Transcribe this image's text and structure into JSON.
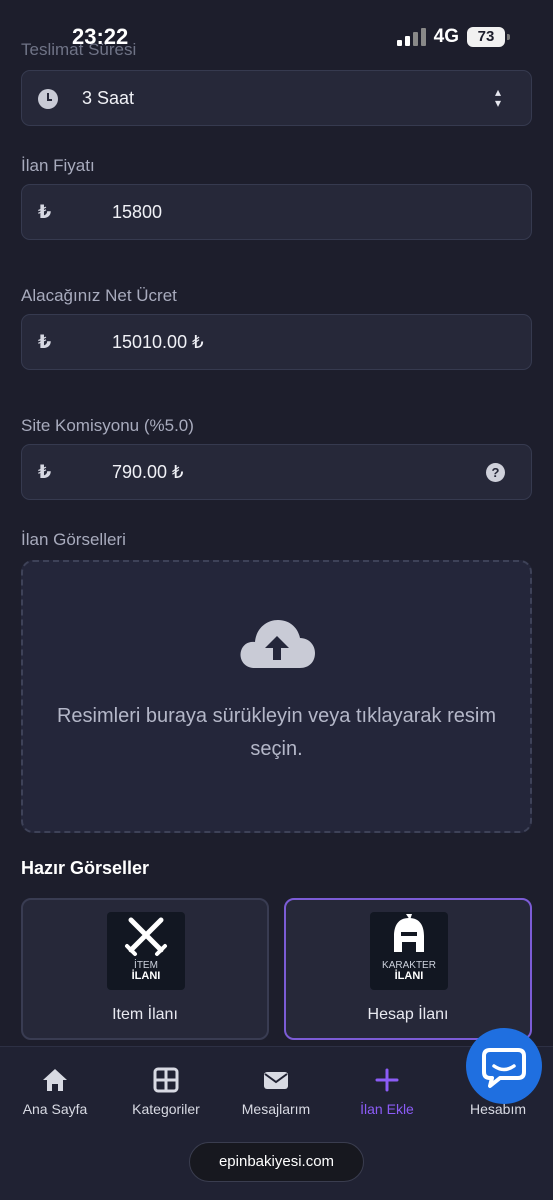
{
  "status_bar": {
    "time": "23:22",
    "network": "4G",
    "battery": "73"
  },
  "form": {
    "delivery": {
      "label": "Teslimat Süresi",
      "value": "3 Saat"
    },
    "price": {
      "label": "İlan Fiyatı",
      "currency_symbol": "₺",
      "value": "15800"
    },
    "net": {
      "label": "Alacağınız Net Ücret",
      "currency_symbol": "₺",
      "value": "15010.00 ₺"
    },
    "commission": {
      "label": "Site Komisyonu (%5.0)",
      "currency_symbol": "₺",
      "value": "790.00 ₺",
      "help": "?"
    },
    "images": {
      "label": "İlan Görselleri",
      "dropzone_text": "Resimleri buraya sürükleyin veya tıklayarak resim seçin."
    }
  },
  "ready_images": {
    "title": "Hazır Görseller",
    "cards": [
      {
        "image_line1": "İTEM",
        "image_line2": "İLANI",
        "title": "Item İlanı",
        "selected": false
      },
      {
        "image_line1": "KARAKTER",
        "image_line2": "İLANI",
        "title": "Hesap İlanı",
        "selected": true
      }
    ]
  },
  "nav": {
    "items": [
      {
        "label": "Ana Sayfa",
        "icon": "home-icon"
      },
      {
        "label": "Kategoriler",
        "icon": "grid-icon"
      },
      {
        "label": "Mesajlarım",
        "icon": "mail-icon"
      },
      {
        "label": "İlan Ekle",
        "icon": "plus-icon",
        "active": true
      },
      {
        "label": "Hesabım",
        "icon": "user-icon"
      }
    ],
    "domain": "epinbakiyesi.com"
  },
  "colors": {
    "accent": "#8b5cf6",
    "background": "#1d1e2c",
    "field": "#262839",
    "chat": "#1f6fe0"
  }
}
